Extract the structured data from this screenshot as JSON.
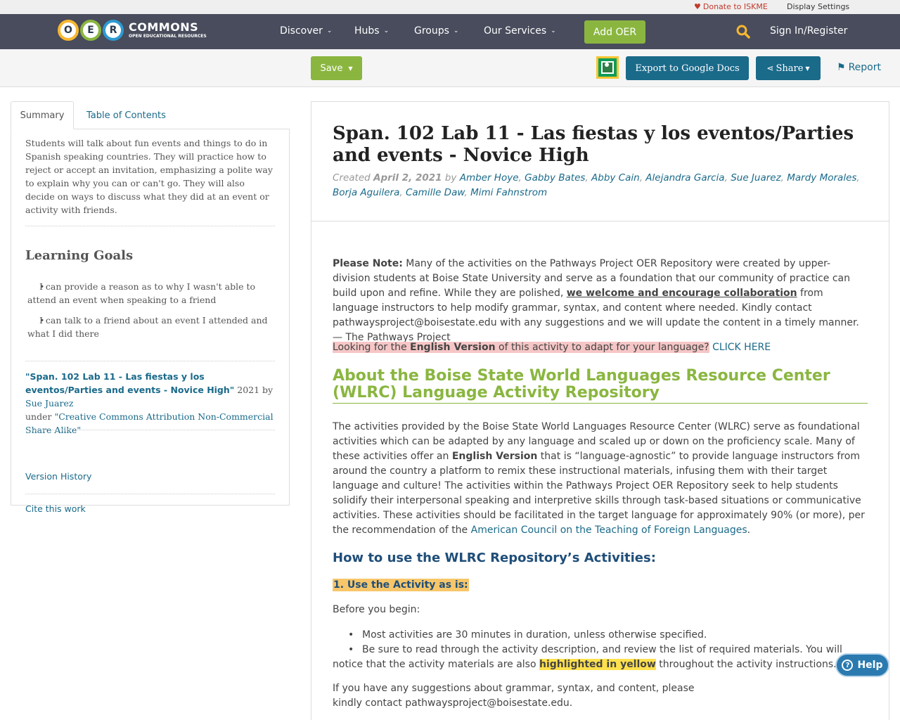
{
  "utility": {
    "donate": "Donate to ISKME",
    "display_settings": "Display Settings"
  },
  "nav": {
    "logo_big": "COMMONS",
    "logo_small": "OPEN EDUCATIONAL RESOURCES",
    "logo_letters": [
      "O",
      "E",
      "R"
    ],
    "discover": "Discover",
    "hubs": "Hubs",
    "groups": "Groups",
    "services": "Our Services",
    "add_oer": "Add OER",
    "signin": "Sign In/Register"
  },
  "toolbar": {
    "save": "Save",
    "export": "Export to Google Docs",
    "share": "Share",
    "report": "Report"
  },
  "sidebar": {
    "tab_summary": "Summary",
    "tab_toc": "Table of Contents",
    "summary": "Students will talk about fun events and things to do in Spanish speaking countries. They will practice how to reject or accept an invitation, emphasizing a polite way to explain why you can or can't go. They will also decide on ways to discuss what they did at an event or activity with friends.",
    "learning_goals_title": "Learning Goals",
    "goals": [
      "I can provide a reason as to why I wasn't able to attend an event when speaking to a friend",
      "I can talk to a friend about an event I attended and what I did there"
    ],
    "attribution_title": "\"Span. 102 Lab 11 - Las fiestas y los eventos/Parties and events - Novice High\"",
    "attribution_year_by": " 2021 by ",
    "attribution_author": "Sue Juarez",
    "attribution_under": "under ",
    "license": "\"Creative Commons Attribution Non-Commercial Share Alike\"",
    "version_history": "Version History",
    "cite": "Cite this work"
  },
  "main": {
    "title": "Span. 102 Lab 11 - Las fiestas y los eventos/Parties and events - Novice High",
    "created_label": "Created ",
    "created_date": "April 2, 2021",
    "by": " by ",
    "authors": [
      "Amber Hoye",
      "Gabby Bates",
      "Abby Cain",
      "Alejandra Garcia",
      "Sue Juarez",
      "Mardy Morales",
      "Borja Aguilera",
      "Camille Daw",
      "Mimi Fahnstrom"
    ],
    "note_label": "Please Note:",
    "note_a": " Many of the activities on the Pathways Project OER Repository were created by upper-division students at Boise State University and serve as a foundation that our community of practice can build upon and refine. While they are polished, ",
    "note_u": "we welcome and encourage collaboration",
    "note_b": " from language instructors to help modify grammar, syntax, and content where needed. Kindly contact pathwaysproject@boisestate.edu with any suggestions and we will update the content in a timely manner.  — The Pathways Project",
    "looking_a": "Looking for the ",
    "looking_b": "English Version",
    "looking_c": " of this activity to adapt for your language?",
    "click_here": "CLICK HERE",
    "about_heading": "About the Boise State World Languages Resource Center (WLRC) Language Activity Repository",
    "about_a": "The activities provided by the Boise State World Languages Resource Center (WLRC) serve as foundational activities which can be adapted by any language and scaled up or down on the proficiency scale. Many of these activities offer an ",
    "about_b": "English Version",
    "about_c": " that is “language-agnostic” to provide language instructors from around the country a platform to remix these instructional materials, infusing them with their target language and culture! The activities within the Pathways Project OER Repository seek to help students solidify their interpersonal speaking and interpretive skills through task-based situations or communicative activities. These activities should be facilitated in the target language for approximately 90% (or more), per the recommendation of the ",
    "actfl": "American Council on the Teaching of Foreign Languages",
    "about_end": ".",
    "how_heading": "How to use the WLRC Repository’s Activities:",
    "use_heading": "1. Use the Activity as is:",
    "before": "Before you begin:",
    "bullet1": "Most activities are 30 minutes in duration, unless otherwise specified.",
    "bullet2_a": "Be sure to read through the activity description, and review the list of required materials. You will notice that the activity materials are also ",
    "bullet2_b": "highlighted in yellow",
    "bullet2_c": " throughout the activity instructions.",
    "suggest": "If you have any suggestions about grammar, syntax, and content, please kindly contact pathwaysproject@boisestate.edu."
  },
  "help": {
    "label": "Help"
  },
  "colors": {
    "nav_bg": "#484c5c",
    "accent_green": "#8ab640",
    "link_blue": "#1a6a8a",
    "heading_blue": "#1f4e79"
  }
}
